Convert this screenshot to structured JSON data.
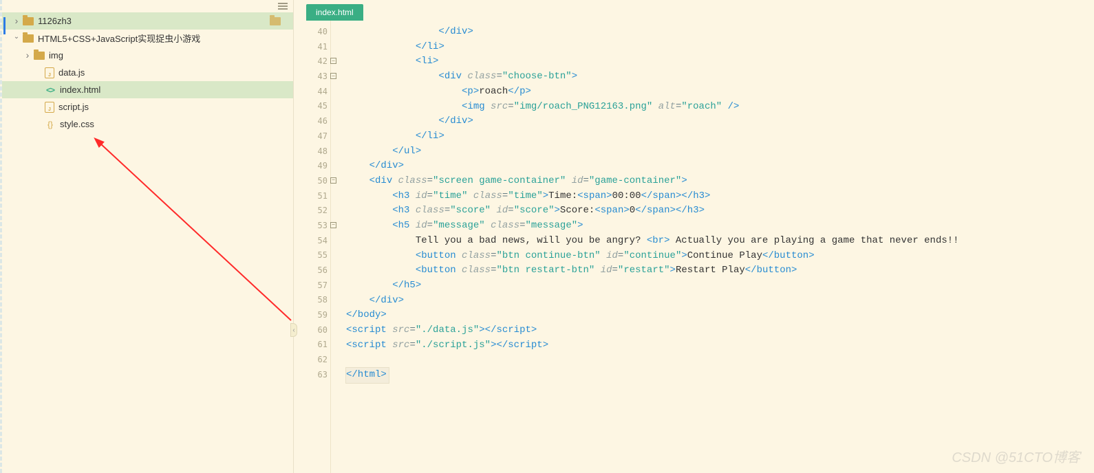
{
  "sidebar": {
    "items": [
      {
        "label": "1126zh3",
        "kind": "folder-closed",
        "level": 0,
        "arrow": "right",
        "highlight": true,
        "end_icon": "folder"
      },
      {
        "label": "HTML5+CSS+JavaScript实现捉虫小游戏",
        "kind": "folder-open",
        "level": 0,
        "arrow": "down",
        "highlight": false
      },
      {
        "label": "img",
        "kind": "folder-closed",
        "level": 1,
        "arrow": "right",
        "highlight": false
      },
      {
        "label": "data.js",
        "kind": "js",
        "level": 2,
        "arrow": "none",
        "highlight": false
      },
      {
        "label": "index.html",
        "kind": "html",
        "level": 2,
        "arrow": "none",
        "highlight": true
      },
      {
        "label": "script.js",
        "kind": "js",
        "level": 2,
        "arrow": "none",
        "highlight": false
      },
      {
        "label": "style.css",
        "kind": "css",
        "level": 2,
        "arrow": "none",
        "highlight": false
      }
    ]
  },
  "tab": {
    "label": "index.html"
  },
  "gutter": {
    "start": 40,
    "end": 63,
    "folds": {
      "42": "-",
      "43": "-",
      "50": "-",
      "53": "-"
    }
  },
  "code_lines": [
    "                </div>",
    "            </li>",
    "            <li>",
    "                <div class=\"choose-btn\">",
    "                    <p>roach</p>",
    "                    <img src=\"img/roach_PNG12163.png\" alt=\"roach\" />",
    "                </div>",
    "            </li>",
    "        </ul>",
    "    </div>",
    "    <div class=\"screen game-container\" id=\"game-container\">",
    "        <h3 id=\"time\" class=\"time\">Time:<span>00:00</span></h3>",
    "        <h3 class=\"score\" id=\"score\">Score:<span>0</span></h3>",
    "        <h5 id=\"message\" class=\"message\">",
    "            Tell you a bad news, will you be angry? <br> Actually you are playing a game that never ends!!",
    "            <button class=\"btn continue-btn\" id=\"continue\">Continue Play</button>",
    "            <button class=\"btn restart-btn\" id=\"restart\">Restart Play</button>",
    "        </h5>",
    "    </div>",
    "</body>",
    "<script src=\"./data.js\"></script>",
    "<script src=\"./script.js\"></script>",
    "",
    "</html>"
  ],
  "watermark": "CSDN @51CTO博客"
}
